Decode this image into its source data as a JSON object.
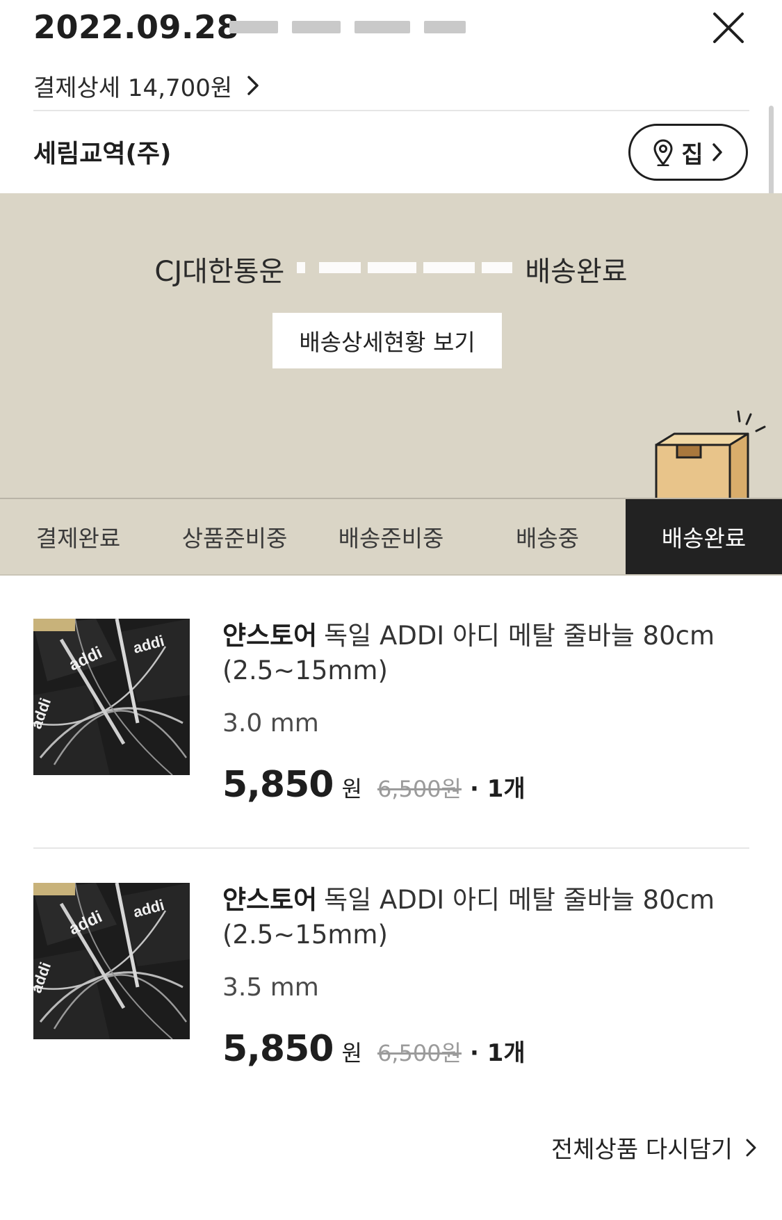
{
  "header": {
    "date": "2022.09.28",
    "payment_detail": "결제상세 14,700원",
    "close_icon": "close-icon"
  },
  "seller": {
    "name": "세림교역(주)",
    "address_label": "집"
  },
  "shipping": {
    "courier": "CJ대한통운",
    "status": "배송완료",
    "detail_button": "배송상세현황 보기"
  },
  "steps": [
    {
      "label": "결제완료",
      "active": false
    },
    {
      "label": "상품준비중",
      "active": false
    },
    {
      "label": "배송준비중",
      "active": false
    },
    {
      "label": "배송중",
      "active": false
    },
    {
      "label": "배송완료",
      "active": true
    }
  ],
  "products": [
    {
      "store": "얀스토어",
      "title": "독일 ADDI 아디 메탈 줄바늘 80cm (2.5~15mm)",
      "option": "3.0 mm",
      "price": "5,850",
      "unit": "원",
      "original_price": "6,500원",
      "quantity": "· 1개"
    },
    {
      "store": "얀스토어",
      "title": "독일 ADDI 아디 메탈 줄바늘 80cm (2.5~15mm)",
      "option": "3.5 mm",
      "price": "5,850",
      "unit": "원",
      "original_price": "6,500원",
      "quantity": "· 1개"
    }
  ],
  "footer": {
    "re_add_all": "전체상품 다시담기"
  },
  "colors": {
    "banner_bg": "#dad5c6",
    "active_step_bg": "#222222",
    "box": "#e8c48a"
  }
}
